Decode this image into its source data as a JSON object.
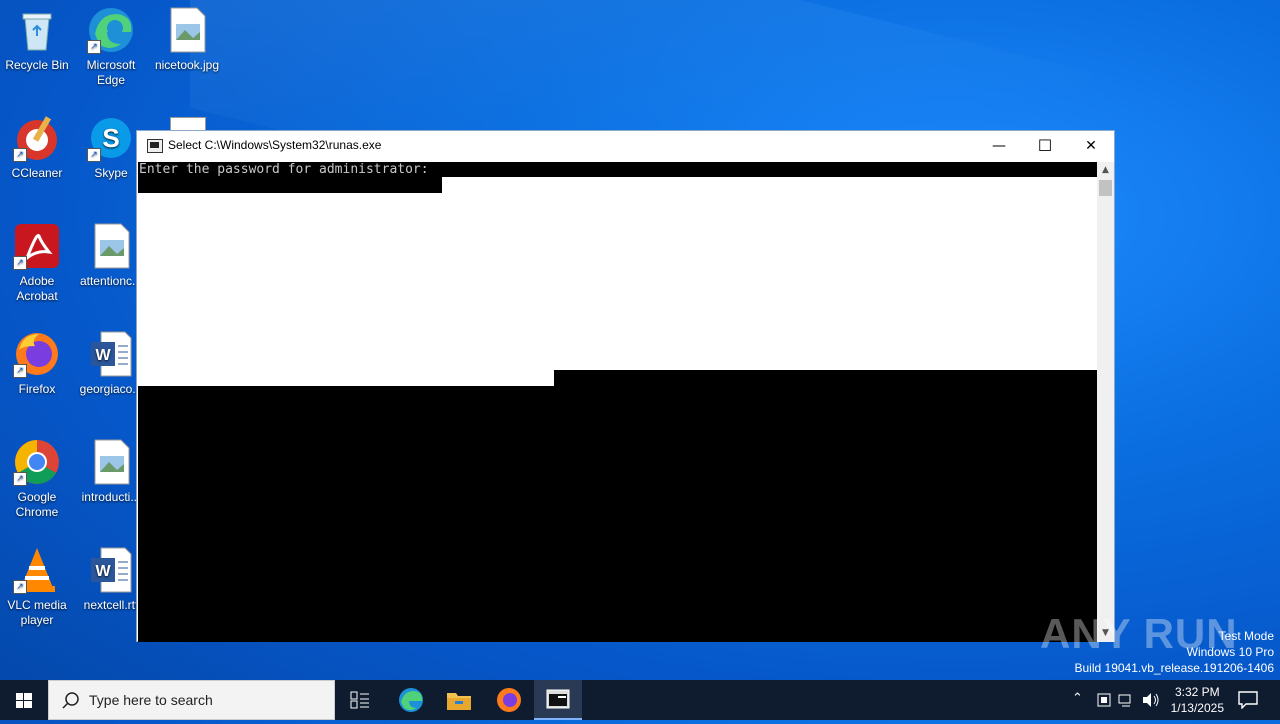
{
  "desktop": {
    "icons": [
      {
        "label": "Recycle Bin"
      },
      {
        "label": "Microsoft Edge"
      },
      {
        "label": "nicetook.jpg"
      },
      {
        "label": "CCleaner"
      },
      {
        "label": "Skype"
      },
      {
        "label": "Adobe Acrobat"
      },
      {
        "label": "attentionc..."
      },
      {
        "label": "Firefox"
      },
      {
        "label": "georgiaco..."
      },
      {
        "label": "Google Chrome"
      },
      {
        "label": "introducti..."
      },
      {
        "label": "VLC media player"
      },
      {
        "label": "nextcell.rtf"
      }
    ]
  },
  "window": {
    "title": "Select C:\\Windows\\System32\\runas.exe",
    "console_text": "Enter the password for administrator:",
    "minimize_glyph": "—",
    "maximize_glyph": "☐",
    "close_glyph": "✕"
  },
  "watermark": {
    "line1": "Test Mode",
    "line2": "Windows 10 Pro",
    "line3": "Build 19041.vb_release.191206-1406",
    "brand": "ANY RUN"
  },
  "taskbar": {
    "search_placeholder": "Type here to search",
    "time": "3:32 PM",
    "date": "1/13/2025"
  },
  "colors": {
    "desktop_blue": "#0a6ee0",
    "taskbar": "#0f1b2e",
    "console_bg": "#000000"
  }
}
